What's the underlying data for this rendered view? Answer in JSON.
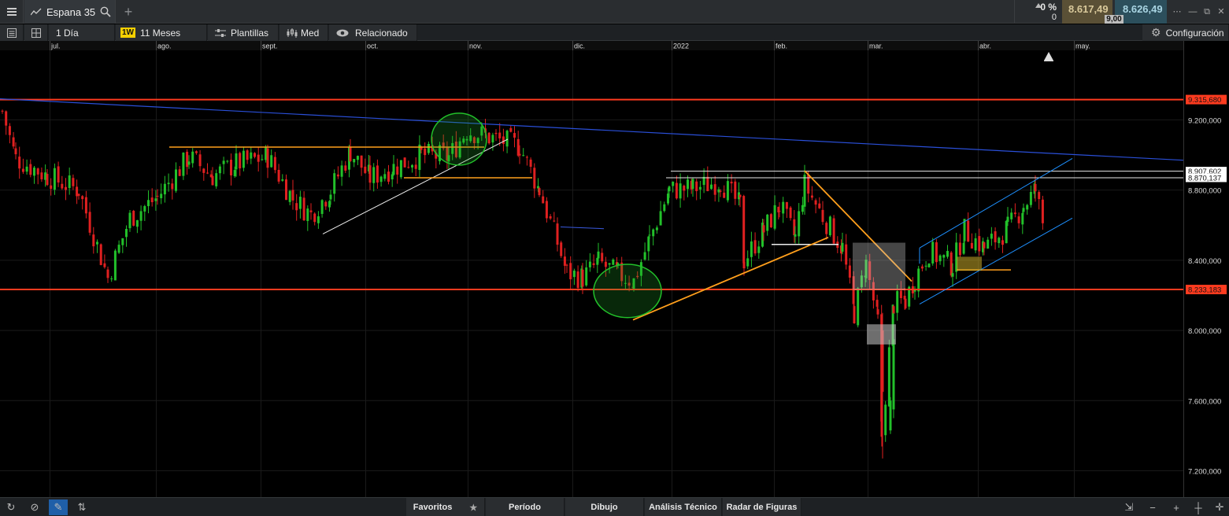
{
  "header": {
    "instrument": "Espana 35",
    "change_pct": "0 %",
    "change_val": "0",
    "sell_price": "8.617,49",
    "spread": "9,00",
    "buy_price": "8.626,49"
  },
  "toolbar": {
    "interval": "1 Día",
    "badge": "1W",
    "range": "11 Meses",
    "templates": "Plantillas",
    "med": "Med",
    "related": "Relacionado",
    "config": "Configuración"
  },
  "bottombar": {
    "favorites": "Favoritos",
    "period": "Período",
    "drawing": "Dibujo",
    "technical": "Análisis Técnico",
    "radar": "Radar de Figuras"
  },
  "colors": {
    "up": "#22c02a",
    "down": "#e02020",
    "hline": "#ff3b1f",
    "trend_blue": "#2a4fd8",
    "orange": "#ff9f1c",
    "channel": "#1e90ff"
  },
  "chart_data": {
    "type": "candlestick",
    "x_tick_labels": [
      "jul.",
      "ago.",
      "sept.",
      "oct.",
      "nov.",
      "dic.",
      "2022",
      "feb.",
      "mar.",
      "abr.",
      "may."
    ],
    "y_tick_values": [
      9200000,
      8800000,
      8400000,
      8000000,
      7600000,
      7200000
    ],
    "y_tick_labels": [
      "9.200,000",
      "8.800,000",
      "8.400,000",
      "8.000,000",
      "7.600,000",
      "7.200,000"
    ],
    "ylim": [
      7050000,
      9650000
    ],
    "price_labels": [
      {
        "value": 9315680,
        "label": "9.315,680",
        "style": "red"
      },
      {
        "value": 8907602,
        "label": "8.907,602",
        "style": "white"
      },
      {
        "value": 8870137,
        "label": "8.870,137",
        "style": "white"
      },
      {
        "value": 8233183,
        "label": "8.233,183",
        "style": "red"
      }
    ]
  }
}
